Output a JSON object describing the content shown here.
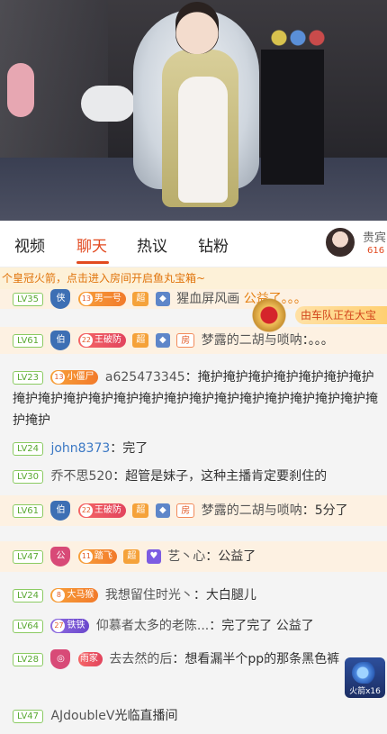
{
  "tabs": [
    "视频",
    "聊天",
    "热议",
    "钻粉"
  ],
  "guest": {
    "label": "贵宾",
    "count": "616"
  },
  "notice": "个皇冠火箭，点击进入房间开启鱼丸宝箱~",
  "overlay": {
    "text": "由车队正在大宝"
  },
  "rocket": {
    "label": "火箭x16"
  },
  "messages": [
    {
      "lv": "LV35",
      "shield": "侠",
      "fan": "男一号",
      "fan_lv": "13",
      "badge": "超",
      "user": "猩血屏风画",
      "text": "公益了。。。"
    },
    {
      "lv": "LV61",
      "shield": "伯",
      "fan": "王破防",
      "fan_lv": "22",
      "badge": "超",
      "user": "梦露的二胡与唢呐",
      "text": "：。。。"
    },
    {
      "lv": "LV23",
      "fan": "小僵尸",
      "fan_lv": "13",
      "user": "a625473345",
      "text": "：掩护掩护掩护掩护掩护掩护掩护掩护掩护掩护掩护掩护掩护掩护掩护掩护掩护掩护掩护掩护掩护掩护掩护"
    },
    {
      "lv": "LV24",
      "user": "john8373",
      "text": "：完了"
    },
    {
      "lv": "LV30",
      "user": "乔不思520",
      "text": "：超管是妹子，这种主播肯定要刹住的"
    },
    {
      "lv": "LV61",
      "shield": "伯",
      "fan": "王破防",
      "fan_lv": "22",
      "badge": "超",
      "user": "梦露的二胡与唢呐",
      "text": "：5分了"
    },
    {
      "lv": "LV47",
      "shield": "公",
      "fan": "踏飞",
      "fan_lv": "11",
      "badge": "超",
      "user": "艺丶心",
      "text": "：公益了"
    },
    {
      "lv": "LV24",
      "fan": "大马猴",
      "fan_lv": "8",
      "user": "我想留住时光丶",
      "text": "：大白腿儿"
    },
    {
      "lv": "LV64",
      "fan": "铁铁",
      "fan_lv": "27",
      "user": "仰慕者太多的老陈...",
      "text": "：完了完了 公益了"
    },
    {
      "lv": "LV28",
      "fan": "雨家",
      "user": "去去然的后",
      "text": "：想看漏半个pp的那条黑色裤"
    },
    {
      "lv": "LV47",
      "user": "AJdoubleV",
      "text": "光临直播间"
    }
  ]
}
